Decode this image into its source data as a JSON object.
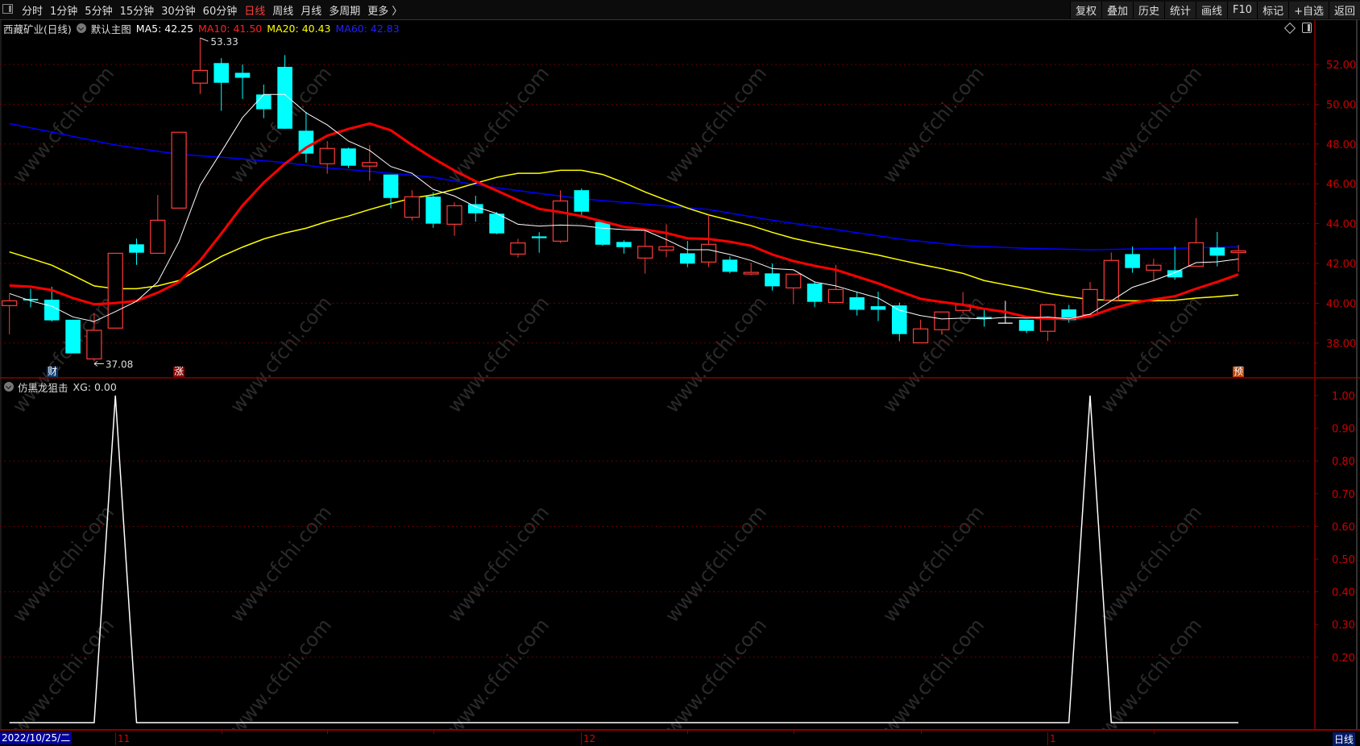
{
  "toolbar": {
    "periods": [
      "分时",
      "1分钟",
      "5分钟",
      "15分钟",
      "30分钟",
      "60分钟",
      "日线",
      "周线",
      "月线",
      "多周期",
      "更多 〉"
    ],
    "active_period": "日线",
    "right_buttons": [
      "复权",
      "叠加",
      "历史",
      "统计",
      "画线",
      "F10",
      "标记",
      "+自选",
      "返回"
    ]
  },
  "main_header": {
    "title": "西藏矿业(日线)",
    "template": "默认主图",
    "ma5": "MA5: 42.25",
    "ma10": "MA10: 41.50",
    "ma20": "MA20: 40.43",
    "ma60": "MA60: 42.83"
  },
  "indicator_header": {
    "name": "仿黑龙狙击",
    "value": "XG: 0.00"
  },
  "badges": {
    "cai": "财",
    "zhang": "涨",
    "yu": "预"
  },
  "annotations": {
    "high": "53.33",
    "low": "37.08"
  },
  "datebar": {
    "current": "2022/10/25/二",
    "period": "日线"
  },
  "watermark": "www.cfchi.com",
  "colors": {
    "up": "#ff3b3b",
    "down": "#00ffff",
    "ma5": "#ffffff",
    "ma10": "#ff0000",
    "ma20": "#ffff00",
    "ma60": "#0000ff",
    "grid": "#8b0000",
    "axis": "#cc0000"
  },
  "chart_data": [
    {
      "type": "candlestick",
      "title": "西藏矿业(日线)",
      "ylim": [
        36.6,
        53.8
      ],
      "yticks": [
        "52.00",
        "50.00",
        "48.00",
        "46.00",
        "44.00",
        "42.00",
        "40.00",
        "38.00"
      ],
      "xticks": [
        {
          "index": 5,
          "label": "11"
        },
        {
          "index": 27,
          "label": "12"
        },
        {
          "index": 49,
          "label": "1"
        }
      ],
      "ohlc": [
        [
          39.88,
          40.46,
          38.44,
          40.12
        ],
        [
          40.22,
          40.73,
          39.79,
          40.15
        ],
        [
          40.18,
          40.83,
          39.08,
          39.14
        ],
        [
          39.17,
          39.17,
          37.48,
          37.48
        ],
        [
          37.2,
          39.52,
          37.08,
          38.64
        ],
        [
          38.75,
          42.51,
          38.75,
          42.51
        ],
        [
          42.96,
          43.25,
          41.93,
          42.54
        ],
        [
          42.51,
          45.44,
          42.51,
          44.17
        ],
        [
          44.78,
          48.59,
          44.78,
          48.59
        ],
        [
          51.06,
          53.33,
          50.52,
          51.7
        ],
        [
          52.07,
          52.32,
          49.67,
          51.08
        ],
        [
          51.58,
          52.0,
          50.27,
          51.33
        ],
        [
          50.49,
          50.99,
          49.3,
          49.75
        ],
        [
          51.88,
          52.47,
          48.77,
          48.77
        ],
        [
          48.67,
          49.61,
          47.07,
          47.52
        ],
        [
          47.01,
          48.15,
          46.51,
          47.78
        ],
        [
          47.78,
          47.82,
          46.8,
          46.91
        ],
        [
          46.89,
          47.95,
          46.16,
          47.07
        ],
        [
          46.47,
          46.47,
          44.77,
          45.29
        ],
        [
          44.32,
          45.68,
          44.16,
          45.35
        ],
        [
          45.36,
          45.58,
          43.79,
          44.0
        ],
        [
          43.97,
          45.08,
          43.39,
          44.9
        ],
        [
          44.98,
          45.4,
          44.1,
          44.52
        ],
        [
          44.5,
          44.58,
          43.47,
          43.51
        ],
        [
          42.47,
          43.24,
          42.3,
          43.03
        ],
        [
          43.36,
          43.57,
          42.54,
          43.27
        ],
        [
          43.12,
          45.67,
          43.03,
          45.14
        ],
        [
          45.68,
          45.77,
          44.39,
          44.6
        ],
        [
          44.09,
          44.09,
          42.89,
          42.94
        ],
        [
          43.08,
          43.16,
          42.49,
          42.82
        ],
        [
          42.27,
          43.63,
          41.49,
          42.86
        ],
        [
          42.67,
          43.97,
          42.31,
          42.84
        ],
        [
          42.51,
          43.13,
          41.81,
          41.99
        ],
        [
          42.07,
          44.44,
          41.81,
          42.96
        ],
        [
          42.19,
          42.35,
          41.5,
          41.58
        ],
        [
          41.5,
          42.04,
          41.41,
          41.55
        ],
        [
          41.5,
          41.99,
          40.64,
          40.85
        ],
        [
          40.77,
          41.46,
          39.95,
          41.46
        ],
        [
          40.99,
          41.1,
          39.8,
          40.07
        ],
        [
          40.04,
          41.93,
          40.04,
          40.69
        ],
        [
          40.3,
          40.57,
          39.38,
          39.67
        ],
        [
          39.85,
          40.58,
          39.1,
          39.67
        ],
        [
          39.89,
          40.03,
          38.09,
          38.45
        ],
        [
          38.01,
          39.17,
          38.01,
          38.71
        ],
        [
          38.67,
          39.58,
          38.41,
          39.56
        ],
        [
          39.64,
          40.56,
          39.49,
          39.92
        ],
        [
          39.31,
          39.65,
          38.82,
          39.21
        ],
        [
          39.0,
          40.12,
          39.0,
          39.0
        ],
        [
          39.17,
          39.17,
          38.5,
          38.61
        ],
        [
          38.59,
          39.92,
          38.1,
          39.92
        ],
        [
          39.69,
          39.92,
          39.02,
          39.15
        ],
        [
          39.42,
          41.07,
          39.42,
          40.69
        ],
        [
          40.16,
          42.55,
          40.16,
          42.15
        ],
        [
          42.47,
          42.85,
          41.53,
          41.77
        ],
        [
          41.66,
          42.24,
          41.1,
          41.91
        ],
        [
          41.66,
          42.85,
          41.18,
          41.3
        ],
        [
          41.86,
          44.28,
          41.86,
          43.04
        ],
        [
          42.8,
          43.58,
          41.85,
          42.39
        ],
        [
          42.55,
          42.93,
          41.58,
          42.63
        ]
      ],
      "series": [
        {
          "name": "MA5",
          "values": [
            40.49,
            40.12,
            39.85,
            39.31,
            39.08,
            39.58,
            40.1,
            41.07,
            43.09,
            45.93,
            47.61,
            49.33,
            50.49,
            50.49,
            49.57,
            48.96,
            48.15,
            47.68,
            46.87,
            46.53,
            45.72,
            45.39,
            44.85,
            44.51,
            43.97,
            43.88,
            43.93,
            43.9,
            43.77,
            43.7,
            43.66,
            43.2,
            42.69,
            42.69,
            42.45,
            42.15,
            41.74,
            41.68,
            41.07,
            40.87,
            40.56,
            40.26,
            39.65,
            39.38,
            39.21,
            39.25,
            39.21,
            39.29,
            39.25,
            39.31,
            39.21,
            39.45,
            40.12,
            40.8,
            41.14,
            41.54,
            42.04,
            42.08,
            42.22
          ]
        },
        {
          "name": "MA10",
          "values": [
            40.89,
            40.83,
            40.66,
            40.26,
            39.95,
            40.01,
            40.12,
            40.53,
            41.07,
            42.15,
            43.5,
            44.91,
            46.06,
            47.01,
            47.82,
            48.42,
            48.76,
            49.03,
            48.69,
            47.95,
            47.28,
            46.67,
            46.13,
            45.66,
            45.18,
            44.74,
            44.58,
            44.38,
            44.11,
            43.84,
            43.7,
            43.53,
            43.26,
            43.23,
            43.09,
            42.89,
            42.45,
            42.12,
            41.88,
            41.68,
            41.34,
            41.0,
            40.6,
            40.22,
            40.06,
            39.92,
            39.72,
            39.56,
            39.31,
            39.23,
            39.21,
            39.34,
            39.72,
            40.01,
            40.19,
            40.35,
            40.73,
            41.07,
            41.45
          ]
        },
        {
          "name": "MA20",
          "values": [
            42.58,
            42.25,
            41.91,
            41.4,
            40.87,
            40.73,
            40.73,
            40.87,
            41.14,
            41.75,
            42.35,
            42.82,
            43.23,
            43.53,
            43.77,
            44.11,
            44.38,
            44.71,
            45.01,
            45.28,
            45.45,
            45.72,
            46.03,
            46.33,
            46.53,
            46.53,
            46.68,
            46.68,
            46.47,
            46.06,
            45.59,
            45.18,
            44.78,
            44.44,
            44.17,
            43.9,
            43.56,
            43.26,
            43.03,
            42.82,
            42.62,
            42.42,
            42.18,
            41.95,
            41.74,
            41.5,
            41.14,
            40.93,
            40.73,
            40.5,
            40.33,
            40.19,
            40.15,
            40.12,
            40.12,
            40.15,
            40.26,
            40.33,
            40.42
          ]
        },
        {
          "name": "MA60",
          "points": [
            [
              0,
              49.03
            ],
            [
              5,
              47.95
            ],
            [
              8,
              47.48
            ],
            [
              10,
              47.34
            ],
            [
              13,
              47.07
            ],
            [
              15,
              46.8
            ],
            [
              17,
              46.63
            ],
            [
              20,
              46.33
            ],
            [
              22,
              45.95
            ],
            [
              24,
              45.66
            ],
            [
              27,
              45.25
            ],
            [
              30,
              44.98
            ],
            [
              33,
              44.71
            ],
            [
              36,
              44.17
            ],
            [
              39,
              43.7
            ],
            [
              42,
              43.23
            ],
            [
              45,
              42.89
            ],
            [
              48,
              42.76
            ],
            [
              51,
              42.69
            ],
            [
              55,
              42.76
            ],
            [
              58,
              42.83
            ]
          ]
        }
      ]
    },
    {
      "type": "line",
      "title": "仿黑龙狙击",
      "ylim": [
        0,
        1.05
      ],
      "yticks": [
        "1.00",
        "0.90",
        "0.80",
        "0.70",
        "0.60",
        "0.50",
        "0.40",
        "0.30",
        "0.20"
      ],
      "series": [
        {
          "name": "XG",
          "values": [
            0,
            0,
            0,
            0,
            0,
            1,
            0,
            0,
            0,
            0,
            0,
            0,
            0,
            0,
            0,
            0,
            0,
            0,
            0,
            0,
            0,
            0,
            0,
            0,
            0,
            0,
            0,
            0,
            0,
            0,
            0,
            0,
            0,
            0,
            0,
            0,
            0,
            0,
            0,
            0,
            0,
            0,
            0,
            0,
            0,
            0,
            0,
            0,
            0,
            0,
            0,
            1,
            0,
            0,
            0,
            0,
            0,
            0,
            0
          ]
        }
      ]
    }
  ]
}
